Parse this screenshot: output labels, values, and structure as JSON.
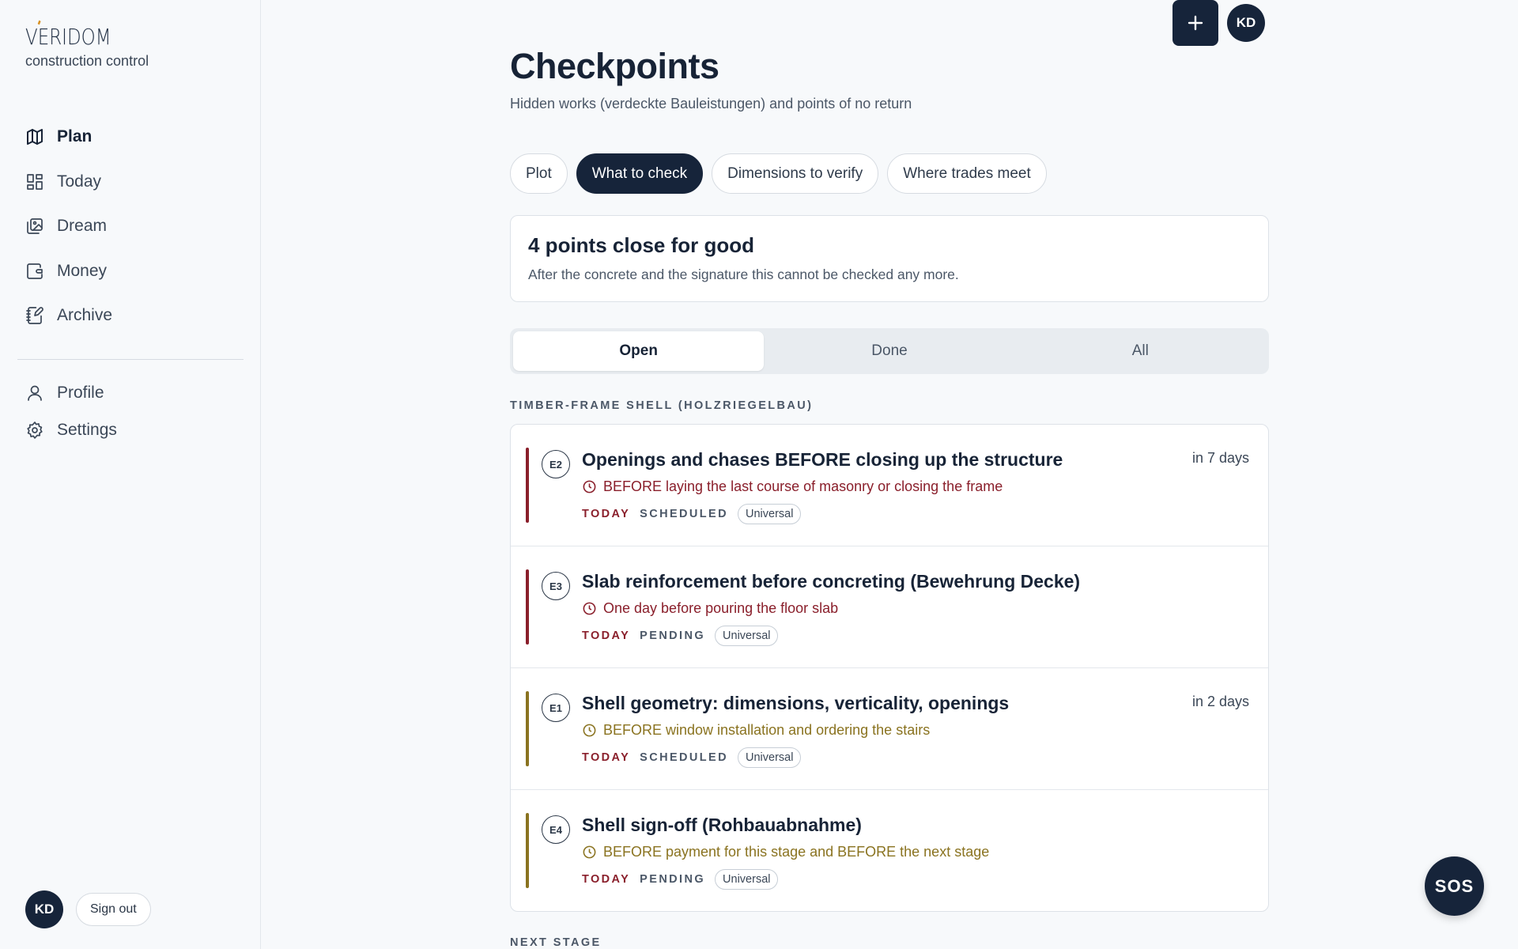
{
  "brand": {
    "logo": "VERIDOM",
    "subtitle": "construction control"
  },
  "sidebar": {
    "nav": [
      {
        "label": "Plan",
        "icon": "map-icon",
        "active": true
      },
      {
        "label": "Today",
        "icon": "dashboard-icon"
      },
      {
        "label": "Dream",
        "icon": "gallery-icon"
      },
      {
        "label": "Money",
        "icon": "wallet-icon"
      },
      {
        "label": "Archive",
        "icon": "notebook-icon"
      }
    ],
    "secondary": [
      {
        "label": "Profile",
        "icon": "user-icon"
      },
      {
        "label": "Settings",
        "icon": "gear-icon"
      }
    ],
    "user_initials": "KD",
    "sign_out": "Sign out"
  },
  "header": {
    "add_icon": "plus-icon",
    "user_initials": "KD"
  },
  "page": {
    "title": "Checkpoints",
    "subtitle": "Hidden works (verdeckte Bauleistungen) and points of no return"
  },
  "tabs": [
    {
      "label": "Plot",
      "active": false
    },
    {
      "label": "What to check",
      "active": true
    },
    {
      "label": "Dimensions to verify",
      "active": false
    },
    {
      "label": "Where trades meet",
      "active": false
    }
  ],
  "summary": {
    "title": "4 points close for good",
    "text": "After the concrete and the signature this cannot be checked any more."
  },
  "filter": {
    "options": [
      "Open",
      "Done",
      "All"
    ],
    "selected": "Open"
  },
  "sections": [
    {
      "label": "TIMBER-FRAME SHELL (HOLZRIEGELBAU)",
      "items": [
        {
          "code": "E2",
          "title": "Openings and chases BEFORE closing up the structure",
          "due": "in 7 days",
          "when": "BEFORE laying the last course of masonry or closing the frame",
          "urgency_color": "#8a1f2b",
          "today": "TODAY",
          "status": "SCHEDULED",
          "scope": "Universal"
        },
        {
          "code": "E3",
          "title": "Slab reinforcement before concreting (Bewehrung Decke)",
          "due": "",
          "when": "One day before pouring the floor slab",
          "urgency_color": "#8a1f2b",
          "today": "TODAY",
          "status": "PENDING",
          "scope": "Universal"
        },
        {
          "code": "E1",
          "title": "Shell geometry: dimensions, verticality, openings",
          "due": "in 2 days",
          "when": "BEFORE window installation and ordering the stairs",
          "urgency_color": "#8a7320",
          "today": "TODAY",
          "status": "SCHEDULED",
          "scope": "Universal"
        },
        {
          "code": "E4",
          "title": "Shell sign-off (Rohbauabnahme)",
          "due": "",
          "when": "BEFORE payment for this stage and BEFORE the next stage",
          "urgency_color": "#8a7320",
          "today": "TODAY",
          "status": "PENDING",
          "scope": "Universal"
        }
      ]
    },
    {
      "label": "NEXT STAGE"
    }
  ],
  "sos": {
    "label": "SOS"
  },
  "colors": {
    "primary": "#16243a",
    "urgent": "#8a1f2b",
    "warning": "#8a7320",
    "background": "#f7f9fb"
  }
}
